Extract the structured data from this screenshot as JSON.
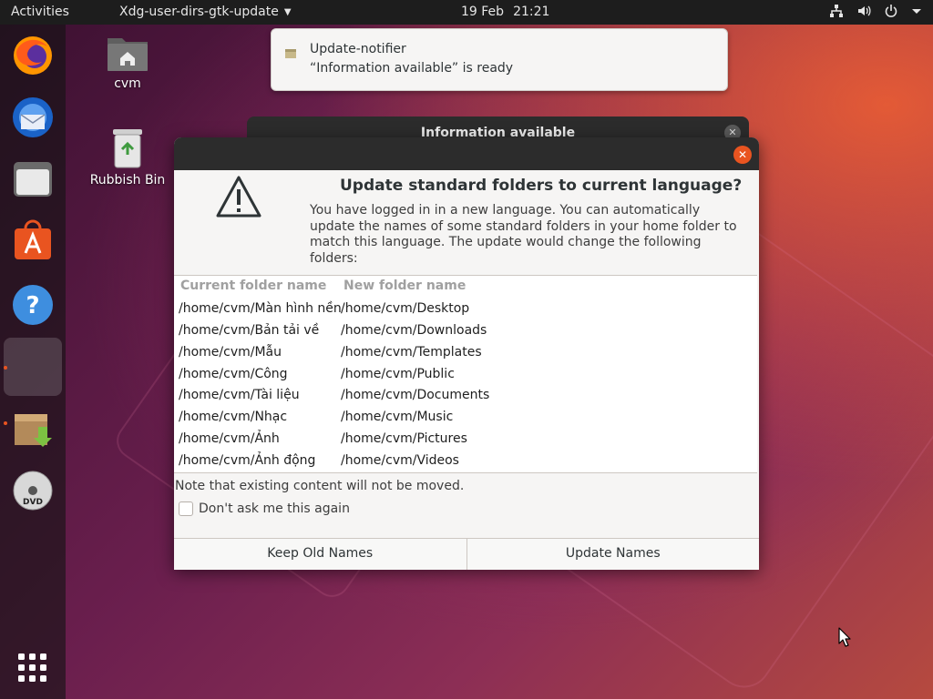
{
  "topbar": {
    "activities": "Activities",
    "app_menu": "Xdg-user-dirs-gtk-update",
    "date": "19 Feb",
    "time": "21:21",
    "tray_icons": [
      "network-icon",
      "volume-icon",
      "power-icon",
      "chevron-down-icon"
    ]
  },
  "dock": {
    "items": [
      "firefox-icon",
      "thunderbird-icon",
      "files-icon",
      "software-icon",
      "help-icon",
      "active-window-icon",
      "archive-install-icon",
      "dvd-icon"
    ],
    "show_apps": "app-grid-icon"
  },
  "desktop": {
    "icons": [
      {
        "label": "cvm",
        "icon": "home-folder-icon"
      },
      {
        "label": "Rubbish Bin",
        "icon": "trash-icon"
      }
    ]
  },
  "notification": {
    "title": "Update-notifier",
    "body": "“Information available” is ready"
  },
  "background_window": {
    "title": "Information available"
  },
  "dialog": {
    "heading": "Update standard folders to current language?",
    "message": "You have logged in in a new language. You can automatically update the names of some standard folders in your home folder to match this language. The update would change the following folders:",
    "columns": [
      "Current folder name",
      "New folder name"
    ],
    "rows": [
      [
        "/home/cvm/Màn hình nền",
        "/home/cvm/Desktop"
      ],
      [
        "/home/cvm/Bản tải về",
        "/home/cvm/Downloads"
      ],
      [
        "/home/cvm/Mẫu",
        "/home/cvm/Templates"
      ],
      [
        "/home/cvm/Công",
        "/home/cvm/Public"
      ],
      [
        "/home/cvm/Tài liệu",
        "/home/cvm/Documents"
      ],
      [
        "/home/cvm/Nhạc",
        "/home/cvm/Music"
      ],
      [
        "/home/cvm/Ảnh",
        "/home/cvm/Pictures"
      ],
      [
        "/home/cvm/Ảnh động",
        "/home/cvm/Videos"
      ]
    ],
    "note": "Note that existing content will not be moved.",
    "checkbox_label": "Don't ask me this again",
    "checkbox_checked": false,
    "buttons": {
      "keep": "Keep Old Names",
      "update": "Update Names"
    }
  },
  "colors": {
    "accent": "#e95420",
    "topbar": "#1d1d1d",
    "titlebar": "#2c2c2c",
    "dialog_bg": "#f6f5f4"
  }
}
